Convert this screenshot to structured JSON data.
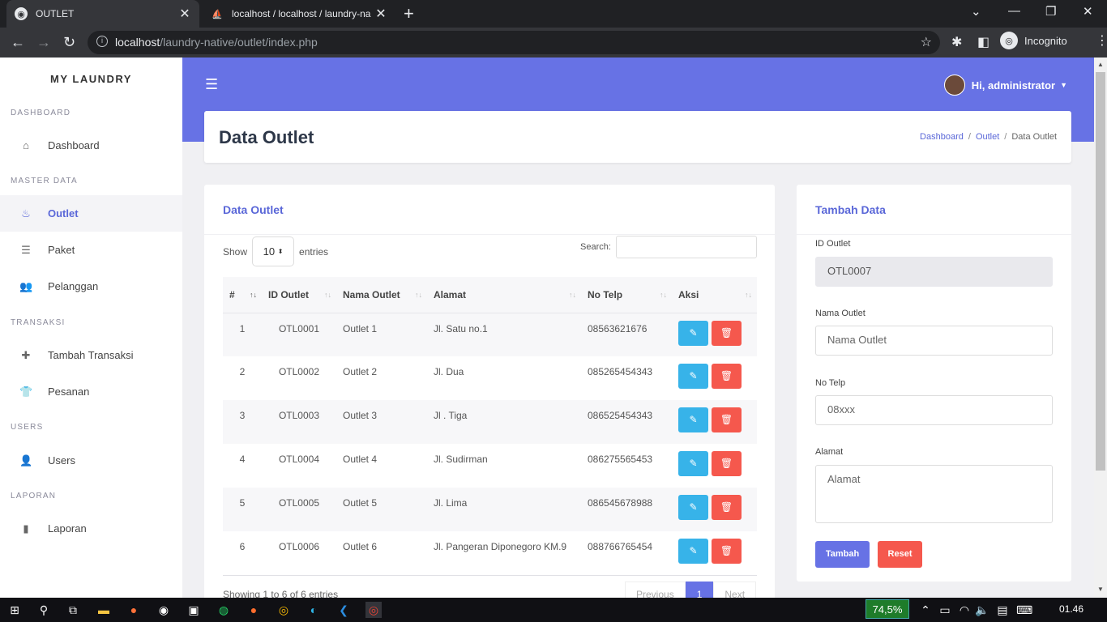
{
  "browser": {
    "tabs": [
      {
        "title": "OUTLET",
        "active": true
      },
      {
        "title": "localhost / localhost / laundry-na",
        "active": false
      }
    ],
    "url_host": "localhost",
    "url_path": "/laundry-native/outlet/index.php",
    "profile_label": "Incognito"
  },
  "sidebar": {
    "brand": "MY LAUNDRY",
    "sections": {
      "dashboard": "DASHBOARD",
      "master": "MASTER DATA",
      "transaksi": "TRANSAKSI",
      "users": "USERS",
      "laporan": "LAPORAN"
    },
    "items": {
      "dashboard": "Dashboard",
      "outlet": "Outlet",
      "paket": "Paket",
      "pelanggan": "Pelanggan",
      "tambah_transaksi": "Tambah Transaksi",
      "pesanan": "Pesanan",
      "users": "Users",
      "laporan": "Laporan"
    }
  },
  "topbar": {
    "user_greeting": "Hi, administrator"
  },
  "header": {
    "title": "Data Outlet",
    "breadcrumb": [
      "Dashboard",
      "Outlet",
      "Data Outlet"
    ]
  },
  "table_card": {
    "title": "Data Outlet",
    "show_label": "Show",
    "entries_value": "10",
    "entries_label": "entries",
    "search_label": "Search:",
    "columns": [
      "#",
      "ID Outlet",
      "Nama Outlet",
      "Alamat",
      "No Telp",
      "Aksi"
    ],
    "rows": [
      {
        "no": "1",
        "id": "OTL0001",
        "nama": "Outlet 1",
        "alamat": "Jl. Satu no.1",
        "telp": "08563621676"
      },
      {
        "no": "2",
        "id": "OTL0002",
        "nama": "Outlet 2",
        "alamat": "Jl. Dua",
        "telp": "085265454343"
      },
      {
        "no": "3",
        "id": "OTL0003",
        "nama": "Outlet 3",
        "alamat": "Jl . Tiga",
        "telp": "086525454343"
      },
      {
        "no": "4",
        "id": "OTL0004",
        "nama": "Outlet 4",
        "alamat": "Jl. Sudirman",
        "telp": "086275565453"
      },
      {
        "no": "5",
        "id": "OTL0005",
        "nama": "Outlet 5",
        "alamat": "Jl. Lima",
        "telp": "086545678988"
      },
      {
        "no": "6",
        "id": "OTL0006",
        "nama": "Outlet 6",
        "alamat": "Jl. Pangeran Diponegoro KM.9",
        "telp": "088766765454"
      }
    ],
    "info": "Showing 1 to 6 of 6 entries",
    "pager": {
      "prev": "Previous",
      "current": "1",
      "next": "Next"
    }
  },
  "form_card": {
    "title": "Tambah Data",
    "id_label": "ID Outlet",
    "id_value": "OTL0007",
    "nama_label": "Nama Outlet",
    "nama_placeholder": "Nama Outlet",
    "telp_label": "No Telp",
    "telp_placeholder": "08xxx",
    "alamat_label": "Alamat",
    "alamat_placeholder": "Alamat",
    "submit_label": "Tambah",
    "reset_label": "Reset"
  },
  "taskbar": {
    "battery": "74,5%",
    "clock": "01.46"
  },
  "colors": {
    "accent": "#6772e5",
    "edit": "#37b3e9",
    "delete": "#f5584d"
  }
}
